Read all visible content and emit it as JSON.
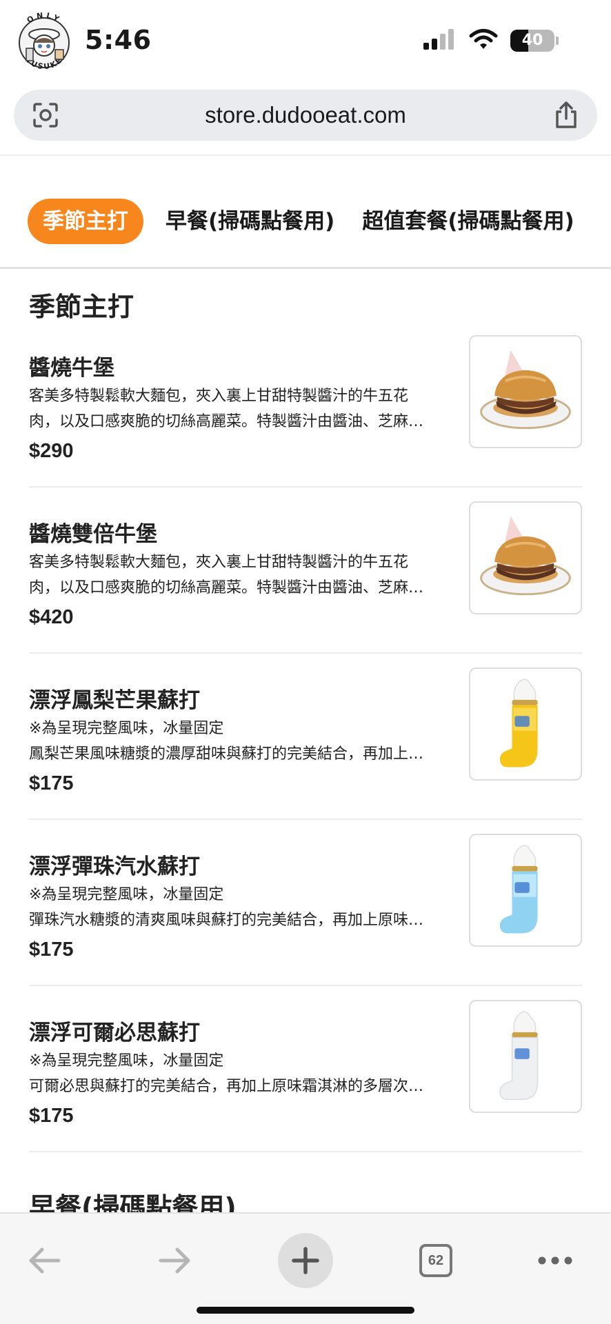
{
  "status_bar": {
    "time": "5:46",
    "battery_level": "40",
    "avatar_top_text": "ONLY",
    "avatar_bottom_text": "YUSUKE"
  },
  "browser": {
    "url": "store.dudooeat.com",
    "open_tabs_count": "62"
  },
  "tabs": [
    {
      "label": "季節主打",
      "active": true
    },
    {
      "label": "早餐(掃碼點餐用)",
      "active": false
    },
    {
      "label": "超值套餐(掃碼點餐用)",
      "active": false
    }
  ],
  "sections": [
    {
      "title": "季節主打",
      "items": [
        {
          "name": "醬燒牛堡",
          "desc": [
            "客美多特製鬆軟大麵包，夾入裏上甘甜特製醬汁的牛五花",
            "肉，以及口感爽脆的切絲高麗菜。特製醬汁由醬油、芝麻…"
          ],
          "price": "$290",
          "image": "burger"
        },
        {
          "name": "醬燒雙倍牛堡",
          "desc": [
            "客美多特製鬆軟大麵包，夾入裏上甘甜特製醬汁的牛五花",
            "肉，以及口感爽脆的切絲高麗菜。特製醬汁由醬油、芝麻…"
          ],
          "price": "$420",
          "image": "burger"
        },
        {
          "name": "漂浮鳳梨芒果蘇打",
          "desc": [
            "※為呈現完整風味，冰量固定",
            "鳳梨芒果風味糖漿的濃厚甜味與蘇打的完美結合，再加上…"
          ],
          "price": "$175",
          "image": "float-yellow"
        },
        {
          "name": "漂浮彈珠汽水蘇打",
          "desc": [
            "※為呈現完整風味，冰量固定",
            "彈珠汽水糖漿的清爽風味與蘇打的完美結合，再加上原味…"
          ],
          "price": "$175",
          "image": "float-blue"
        },
        {
          "name": "漂浮可爾必思蘇打",
          "desc": [
            "※為呈現完整風味，冰量固定",
            "可爾必思與蘇打的完美結合，再加上原味霜淇淋的多層次…"
          ],
          "price": "$175",
          "image": "float-white"
        }
      ]
    },
    {
      "title": "早餐(掃碼點餐用)",
      "items": []
    }
  ],
  "colors": {
    "accent": "#f7861c",
    "text": "#222222",
    "url_bar": "#e9ebee"
  },
  "icons": {
    "url_left": "camera-scan-icon",
    "url_right": "share-icon",
    "back": "back-arrow-icon",
    "forward": "forward-arrow-icon",
    "new_tab": "plus-icon",
    "tabs": "tabs-icon",
    "more": "more-icon"
  }
}
